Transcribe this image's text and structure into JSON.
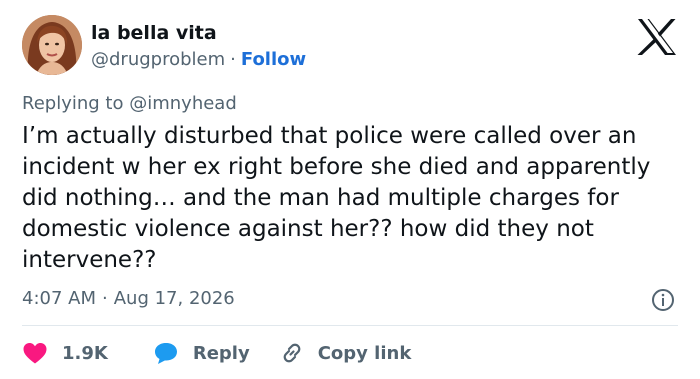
{
  "user": {
    "display_name": "la bella vita",
    "handle": "@drugproblem",
    "separator": "·",
    "follow_label": "Follow"
  },
  "reply_context": {
    "prefix": "Replying to",
    "mention": "@imnyhead"
  },
  "tweet": {
    "text": "I’m actually disturbed that police were called over an incident w her ex right before she died and apparently did nothing… and the man had multiple charges for domestic violence against her?? how did they not intervene??",
    "time": "4:07 AM",
    "separator": "·",
    "date": "Aug 17, 2026"
  },
  "actions": {
    "like_count": "1.9K",
    "reply_label": "Reply",
    "copy_label": "Copy link"
  },
  "icons": {
    "logo": "x-logo-icon",
    "info": "info-icon",
    "like": "heart-icon",
    "reply": "speech-bubble-icon",
    "copy": "link-icon"
  },
  "colors": {
    "text": "#0f1419",
    "secondary": "#536471",
    "follow": "#1d6fd8",
    "like": "#f91880",
    "reply": "#1d9bf0",
    "divider": "#e1e8ed"
  }
}
